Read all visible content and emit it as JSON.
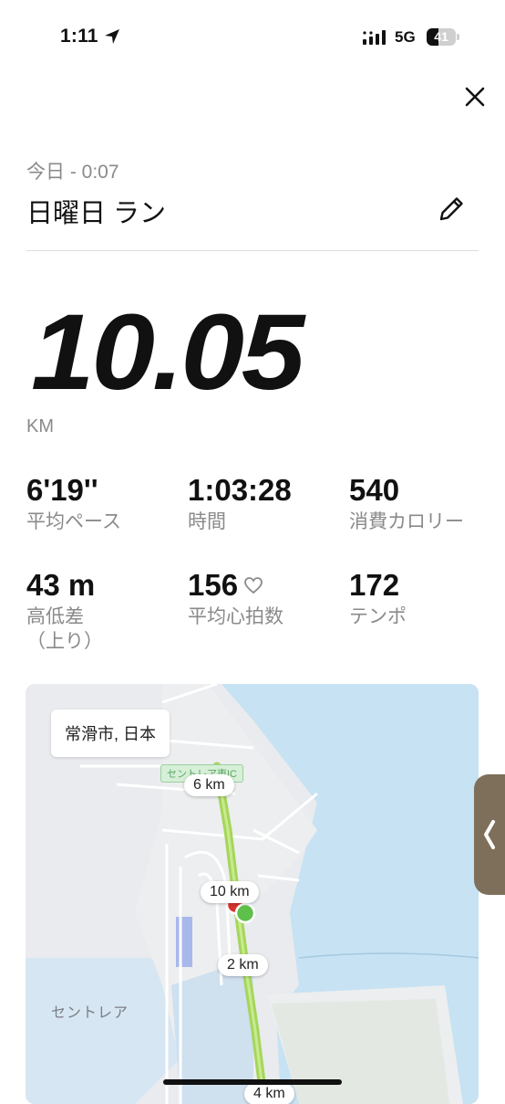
{
  "status_bar": {
    "time": "1:11",
    "network": "5G",
    "battery": "41",
    "battery_level": 0.41
  },
  "header": {
    "subtitle": "今日 - 0:07",
    "title": "日曜日 ラン"
  },
  "summary": {
    "distance": "10.05",
    "unit": "KM"
  },
  "stats": [
    {
      "value": "6'19''",
      "label": "平均ペース"
    },
    {
      "value": "1:03:28",
      "label": "時間"
    },
    {
      "value": "540",
      "label": "消費カロリー"
    },
    {
      "value": "43 m",
      "label": "高低差\n（上り）"
    },
    {
      "value": "156",
      "label": "平均心拍数",
      "icon": "heart-outline-icon"
    },
    {
      "value": "172",
      "label": "テンポ"
    }
  ],
  "map": {
    "location": "常滑市, 日本",
    "place_name": "セントレア",
    "sign_text": "セントレア東IC",
    "markers": {
      "6km": "6 km",
      "10km": "10 km",
      "2km": "2 km",
      "4km": "4 km"
    },
    "colors": {
      "water": "#c6e2f3",
      "land": "#e9ebee",
      "route": "#a5d65b",
      "start": "#5ec04a",
      "end": "#d8332c"
    }
  }
}
